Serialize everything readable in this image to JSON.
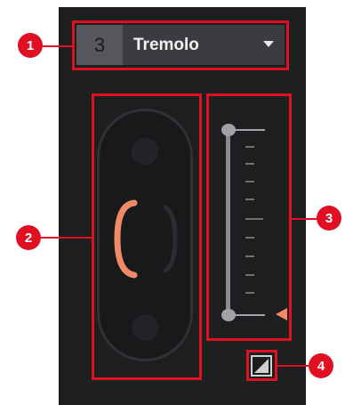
{
  "fx_slot": {
    "number": "3",
    "name": "Tremolo"
  },
  "callouts": [
    "1",
    "2",
    "3",
    "4"
  ],
  "icons": {
    "dropdown": "dropdown-triangle-icon",
    "modulation": "modulation-toggle-icon"
  },
  "colors": {
    "accent": "#f08a64",
    "highlight_box": "#e00f22",
    "panel": "#1c1e20"
  }
}
